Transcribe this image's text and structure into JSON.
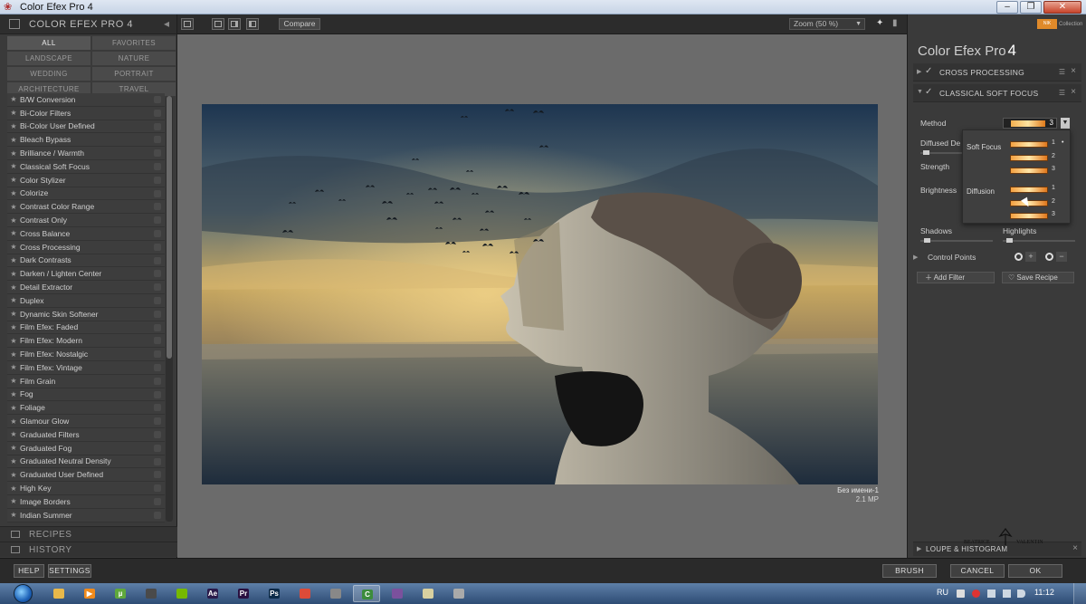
{
  "window": {
    "title": "Color Efex Pro 4",
    "minimize": "–",
    "maximize": "❐",
    "close": "✕"
  },
  "left_panel": {
    "header": "COLOR EFEX PRO 4",
    "categories": [
      "ALL",
      "FAVORITES",
      "LANDSCAPE",
      "NATURE",
      "WEDDING",
      "PORTRAIT",
      "ARCHITECTURE",
      "TRAVEL"
    ],
    "active_category": "ALL",
    "filters": [
      "B/W Conversion",
      "Bi-Color Filters",
      "Bi-Color User Defined",
      "Bleach Bypass",
      "Brilliance / Warmth",
      "Classical Soft Focus",
      "Color Stylizer",
      "Colorize",
      "Contrast Color Range",
      "Contrast Only",
      "Cross Balance",
      "Cross Processing",
      "Dark Contrasts",
      "Darken / Lighten Center",
      "Detail Extractor",
      "Duplex",
      "Dynamic Skin Softener",
      "Film Efex: Faded",
      "Film Efex: Modern",
      "Film Efex: Nostalgic",
      "Film Efex: Vintage",
      "Film Grain",
      "Fog",
      "Foliage",
      "Glamour Glow",
      "Graduated Filters",
      "Graduated Fog",
      "Graduated Neutral Density",
      "Graduated User Defined",
      "High Key",
      "Image Borders",
      "Indian Summer"
    ],
    "recipes": "RECIPES",
    "history": "HISTORY",
    "scroll_fraction": 0.62
  },
  "toolbar": {
    "compare": "Compare",
    "zoom": "Zoom (50 %)"
  },
  "image": {
    "name": "Без имени-1",
    "size": "2.1 MP"
  },
  "right_panel": {
    "collection_logo": "NIK",
    "collection": "Collection",
    "app_title": "Color Efex Pro",
    "app_version": "4",
    "filter_stack": [
      {
        "name": "CROSS PROCESSING",
        "enabled": true,
        "expanded": false
      },
      {
        "name": "CLASSICAL SOFT FOCUS",
        "enabled": true,
        "expanded": true
      }
    ],
    "params": {
      "method_label": "Method",
      "method_value": "3",
      "diffused_label": "Diffused De",
      "diffused_level": 0.05,
      "strength_label": "Strength",
      "brightness_label": "Brightness",
      "shadows_label": "Shadows",
      "shadows_level": 0.05,
      "highlights_label": "Highlights",
      "highlights_level": 0.05
    },
    "method_dropdown": {
      "groups": [
        {
          "label": "Soft Focus",
          "options": [
            "1",
            "2",
            "3"
          ]
        },
        {
          "label": "Diffusion",
          "options": [
            "1",
            "2",
            "3"
          ]
        }
      ],
      "selected_group": "Soft Focus",
      "selected_option": "1"
    },
    "control_points": "Control Points",
    "add_filter": "Add Filter",
    "save_recipe": "Save Recipe",
    "loupe": "LOUPE & HISTOGRAM",
    "watermark": "BEATRICE VALENTIN"
  },
  "bottom": {
    "help": "HELP",
    "settings": "SETTINGS",
    "brush": "BRUSH",
    "cancel": "CANCEL",
    "ok": "OK"
  },
  "taskbar": {
    "apps": [
      {
        "icon": "explorer-icon",
        "color": "#e8b84a",
        "letter": ""
      },
      {
        "icon": "media-player-icon",
        "color": "#f08a1c",
        "letter": "▶"
      },
      {
        "icon": "utorrent-icon",
        "color": "#5fa83c",
        "letter": "µ"
      },
      {
        "icon": "game-icon",
        "color": "#4a4a4a",
        "letter": ""
      },
      {
        "icon": "nvidia-icon",
        "color": "#76b900",
        "letter": ""
      },
      {
        "icon": "after-effects-icon",
        "color": "#2a1a4a",
        "letter": "Ae"
      },
      {
        "icon": "premiere-icon",
        "color": "#2a1040",
        "letter": "Pr"
      },
      {
        "icon": "photoshop-icon",
        "color": "#0b2a48",
        "letter": "Ps"
      },
      {
        "icon": "chrome-icon",
        "color": "#dd4b39",
        "letter": ""
      },
      {
        "icon": "scanner-icon",
        "color": "#888888",
        "letter": ""
      },
      {
        "icon": "camtasia-icon",
        "color": "#3c8c3c",
        "letter": "C"
      },
      {
        "icon": "viber-icon",
        "color": "#7b519d",
        "letter": ""
      },
      {
        "icon": "notes-icon",
        "color": "#d8d0a0",
        "letter": ""
      },
      {
        "icon": "tablet-icon",
        "color": "#aaaaaa",
        "letter": ""
      }
    ],
    "active_app": "camtasia-icon",
    "language": "RU",
    "time": "11:12"
  },
  "colors": {
    "panel": "#3a3a3a",
    "canvas": "#6b6b6b",
    "accent_orange": "#f4a040"
  }
}
